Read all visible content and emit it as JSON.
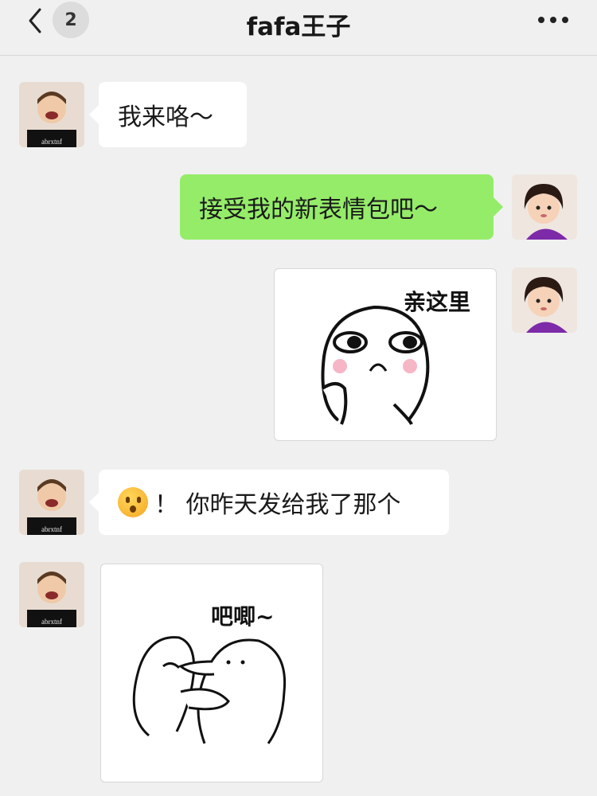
{
  "header": {
    "unread_count": "2",
    "title": "fafa王子"
  },
  "messages": [
    {
      "sender": "boy",
      "side": "left",
      "type": "text",
      "text": "我来咯～"
    },
    {
      "sender": "girl",
      "side": "right",
      "type": "text",
      "text": "接受我的新表情包吧～"
    },
    {
      "sender": "girl",
      "side": "right",
      "type": "sticker",
      "caption": "亲这里"
    },
    {
      "sender": "boy",
      "side": "left",
      "type": "text",
      "emoji": "hushed-face-emoji",
      "text": "！ 你昨天发给我了那个"
    },
    {
      "sender": "boy",
      "side": "left",
      "type": "sticker",
      "caption": "吧唧~"
    }
  ],
  "avatars": {
    "boy_shirt_text": "abrxtnf"
  },
  "colors": {
    "background": "#f0f0f0",
    "my_bubble": "#95ec69",
    "their_bubble": "#ffffff"
  }
}
